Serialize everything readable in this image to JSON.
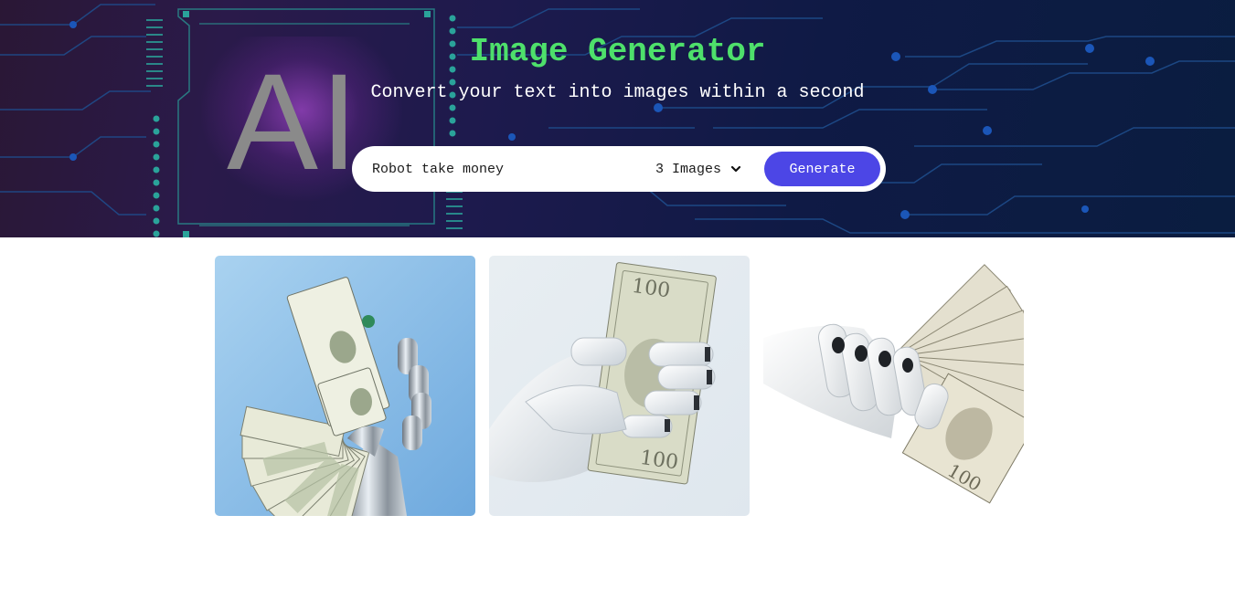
{
  "hero": {
    "title": "Image Generator",
    "subtitle": "Convert your text into images within a second",
    "background_art_text": "AI",
    "title_color": "#4ee06b"
  },
  "form": {
    "prompt_value": "Robot take money",
    "image_count": "3 Images",
    "generate_label": "Generate",
    "button_color": "#4c46e6"
  },
  "gallery": {
    "images": [
      {
        "name": "generated-image-1",
        "subject": "robot hand holding fan of dollar bills on blue background"
      },
      {
        "name": "generated-image-2",
        "subject": "white robot hand holding hundred dollar bills"
      },
      {
        "name": "generated-image-3",
        "subject": "white robot hand holding fan of hundred dollar bills on white"
      }
    ]
  }
}
